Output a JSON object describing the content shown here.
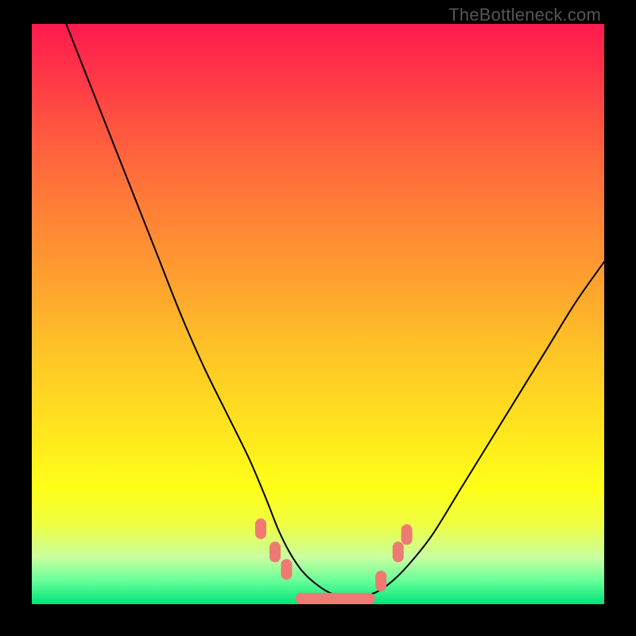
{
  "watermark": "TheBottleneck.com",
  "chart_data": {
    "type": "line",
    "title": "",
    "xlabel": "",
    "ylabel": "",
    "xlim": [
      0,
      100
    ],
    "ylim": [
      0,
      100
    ],
    "grid": false,
    "series": [
      {
        "name": "left-curve",
        "color": "#000000",
        "x": [
          6,
          10,
          14,
          18,
          22,
          26,
          30,
          34,
          38,
          41,
          43,
          45,
          47,
          49,
          52,
          56
        ],
        "values": [
          100,
          90,
          80,
          70,
          60,
          50,
          41,
          33,
          25,
          18,
          13,
          9,
          6,
          4,
          2,
          1
        ]
      },
      {
        "name": "right-curve",
        "color": "#000000",
        "x": [
          56,
          60,
          63,
          66,
          70,
          75,
          80,
          85,
          90,
          95,
          100
        ],
        "values": [
          1,
          2,
          4,
          7,
          12,
          20,
          28,
          36,
          44,
          52,
          59
        ]
      },
      {
        "name": "left-markers",
        "color": "#ef7a73",
        "marker": "rounded-rect",
        "x": [
          40,
          42.5,
          44.5
        ],
        "values": [
          13,
          9,
          6
        ]
      },
      {
        "name": "floor-band",
        "color": "#ef7a73",
        "marker": "wide-rounded-rect",
        "x": [
          53
        ],
        "values": [
          1
        ]
      },
      {
        "name": "right-markers",
        "color": "#ef7a73",
        "marker": "rounded-rect",
        "x": [
          61,
          64,
          65.5
        ],
        "values": [
          4,
          9,
          12
        ]
      }
    ],
    "background_gradient": {
      "direction": "top-to-bottom",
      "stops": [
        {
          "pos": 0,
          "color": "#ff1a4d"
        },
        {
          "pos": 30,
          "color": "#ff7a38"
        },
        {
          "pos": 55,
          "color": "#ffc028"
        },
        {
          "pos": 80,
          "color": "#ffff18"
        },
        {
          "pos": 100,
          "color": "#00e37a"
        }
      ]
    }
  }
}
